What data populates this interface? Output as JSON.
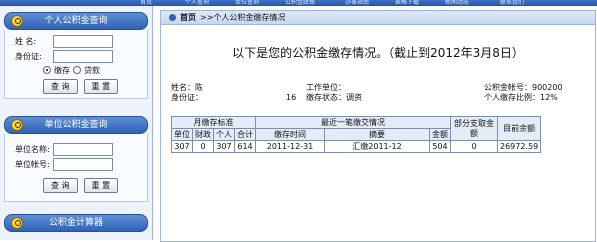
{
  "topnav": [
    "首页",
    "个人查询",
    "单位查询",
    "公积金政策",
    "办事指南",
    "表格下载",
    "新闻动态",
    "联系我们"
  ],
  "sidebar": {
    "personal_panel": {
      "title": "个人公积金查询",
      "name_label": "姓 名:",
      "id_label": "身份证:",
      "radio_deposit": "缴存",
      "radio_loan": "贷款",
      "query_button": "查 询",
      "reset_button": "重 置"
    },
    "unit_panel": {
      "title": "单位公积金查询",
      "unit_name_label": "单位名称:",
      "unit_account_label": "单位帐号:",
      "query_button": "查 询",
      "reset_button": "重 置"
    },
    "calculator_panel": {
      "title": "公积金计算器"
    }
  },
  "breadcrumb": {
    "home": "首页",
    "current": ">>个人公积金缴存情况"
  },
  "heading": "以下是您的公积金缴存情况。（截止到2012年3月8日）",
  "person": {
    "name": "姓名：陈",
    "id": "身份证：",
    "id_tail": "16",
    "employer": "工作单位：",
    "status": "缴存状态：调资",
    "account": "公积金帐号：900200",
    "ratio": "个人缴存比例：12%"
  },
  "table": {
    "group_monthly": "月缴存标准",
    "group_recent": "最近一笔缴交情况",
    "col_unit": "单位",
    "col_fiscal": "财政",
    "col_personal": "个人",
    "col_total": "合计",
    "col_time": "缴存时间",
    "col_summary": "摘要",
    "col_amount": "金额",
    "col_partial": "部分支取金额",
    "col_balance": "目前余额",
    "row": {
      "unit": "307",
      "fiscal": "0",
      "personal": "307",
      "total": "614",
      "time": "2011-12-31",
      "summary": "汇缴2011-12",
      "amount": "504",
      "partial": "0",
      "balance": "26972.59"
    }
  }
}
